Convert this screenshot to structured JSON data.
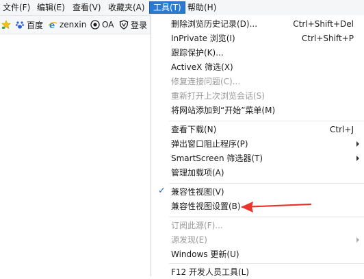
{
  "menubar": {
    "file": "文件(F)",
    "edit": "编辑(E)",
    "view": "查看(V)",
    "favorites": "收藏夹(A)",
    "tools": "工具(T)",
    "help": "帮助(H)"
  },
  "favbar": {
    "baidu": "百度",
    "zenxin": "zenxin",
    "oa": "OA",
    "login": "登录"
  },
  "tools_menu": {
    "items": [
      {
        "label": "删除浏览历史记录(D)...",
        "shortcut": "Ctrl+Shift+Del"
      },
      {
        "label": "InPrivate 浏览(I)",
        "shortcut": "Ctrl+Shift+P"
      },
      {
        "label": "跟踪保护(K)..."
      },
      {
        "label": "ActiveX 筛选(X)"
      },
      {
        "label": "修复连接问题(C)..."
      },
      {
        "label": "重新打开上次浏览会话(S)"
      },
      {
        "label": "将网站添加到“开始”菜单(M)"
      },
      {
        "label": "查看下载(N)",
        "shortcut": "Ctrl+J"
      },
      {
        "label": "弹出窗口阻止程序(P)"
      },
      {
        "label": "SmartScreen 筛选器(T)"
      },
      {
        "label": "管理加载项(A)"
      },
      {
        "label": "兼容性视图(V)"
      },
      {
        "label": "兼容性视图设置(B)"
      },
      {
        "label": "订阅此源(F)..."
      },
      {
        "label": "源发现(E)"
      },
      {
        "label": "Windows 更新(U)"
      },
      {
        "label": "F12 开发人员工具(L)"
      }
    ]
  },
  "colors": {
    "accent": "#2a7ad1",
    "annotation_arrow": "#e8352b",
    "disabled_text": "#9a9a9a"
  }
}
